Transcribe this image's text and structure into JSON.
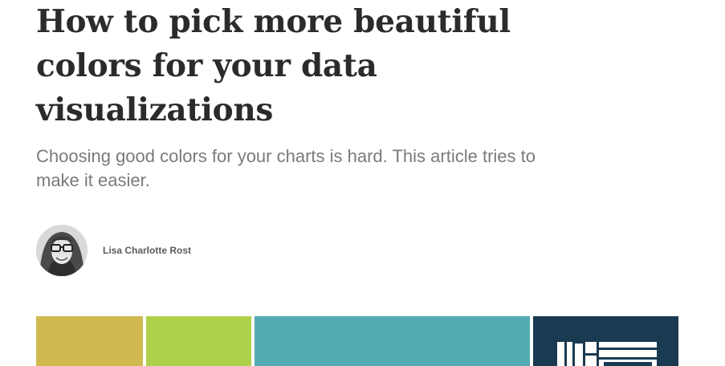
{
  "article": {
    "title": "How to pick more beautiful colors for your data visualizations",
    "subtitle": "Choosing good colors for your charts is hard. This article tries to make it easier.",
    "author": {
      "name": "Lisa Charlotte Rost",
      "avatar_icon": "author-portrait"
    }
  },
  "hero": {
    "swatches": [
      {
        "color": "#d0b94f"
      },
      {
        "color": "#aed14b"
      },
      {
        "color": "#53abb3"
      },
      {
        "color": "#1a3a52"
      }
    ],
    "icon": "treemap-icon"
  }
}
